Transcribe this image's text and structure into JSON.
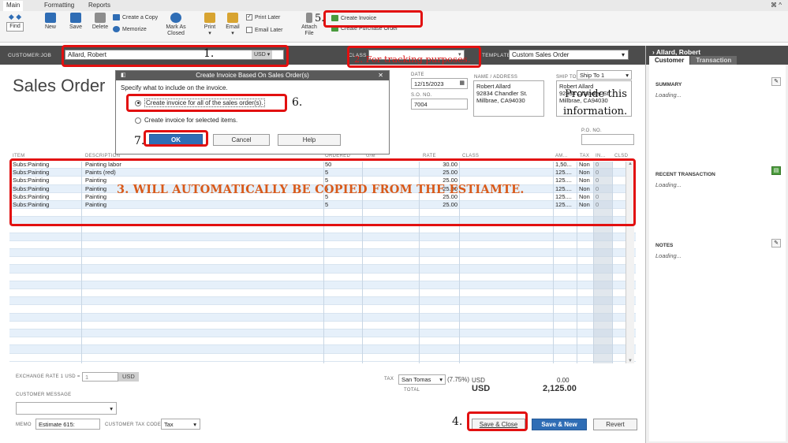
{
  "menu": {
    "tabs": [
      "Main",
      "Formatting",
      "Reports"
    ],
    "window_controls": "⌘ ^"
  },
  "toolbar": {
    "find": "Find",
    "new": "New",
    "save": "Save",
    "delete": "Delete",
    "create_copy": "Create a Copy",
    "memorize": "Memorize",
    "mark_as_closed": [
      "Mark As",
      "Closed"
    ],
    "print": "Print",
    "email": "Email",
    "print_later": "Print Later",
    "email_later": "Email Later",
    "attach_file": [
      "Attach",
      "File"
    ],
    "create_invoice": "Create Invoice",
    "create_purchase_order": "Create Purchase Order"
  },
  "customer_bar": {
    "customer_job_label": "CUSTOMER:JOB",
    "customer_job_value": "Allard, Robert",
    "currency": "USD",
    "class_label": "CLASS",
    "template_label": "TEMPLATE",
    "template_value": "Custom Sales Order"
  },
  "side_panel": {
    "customer_name": "Allard, Robert",
    "tabs": [
      "Customer",
      "Transaction"
    ],
    "summary_label": "SUMMARY",
    "recent_label": "RECENT TRANSACTION",
    "notes_label": "NOTES",
    "loading": "Loading..."
  },
  "form": {
    "title": "Sales Order",
    "date_label": "DATE",
    "date_value": "12/15/2023",
    "so_label": "S.O. NO.",
    "so_value": "7004",
    "name_address_label": "NAME / ADDRESS",
    "name_address": [
      "Robert Allard",
      "92834 Chandler St.",
      "Millbrae, CA94030"
    ],
    "ship_to_label": "SHIP TO",
    "ship_to_value": "Ship To 1",
    "ship_address": [
      "Robert Allard",
      "92834 Chandler St.",
      "Millbrae, CA94030"
    ],
    "po_label": "P.O. NO."
  },
  "table": {
    "headers": [
      "ITEM",
      "DESCRIPTION",
      "ORDERED",
      "U/M",
      "RATE",
      "CLASS",
      "AM...",
      "TAX",
      "IN...",
      "CLSD"
    ],
    "rows": [
      {
        "item": "Subs:Painting",
        "desc": "Painting labor",
        "ordered": "50",
        "rate": "30.00",
        "amount": "1,50...",
        "tax": "Non",
        "inv": "0"
      },
      {
        "item": "Subs:Painting",
        "desc": "Paints (red)",
        "ordered": "5",
        "rate": "25.00",
        "amount": "125....",
        "tax": "Non",
        "inv": "0"
      },
      {
        "item": "Subs:Painting",
        "desc": "Painting",
        "ordered": "5",
        "rate": "25.00",
        "amount": "125....",
        "tax": "Non",
        "inv": "0"
      },
      {
        "item": "Subs:Painting",
        "desc": "Painting",
        "ordered": "5",
        "rate": "25.00",
        "amount": "125....",
        "tax": "Non",
        "inv": "0"
      },
      {
        "item": "Subs:Painting",
        "desc": "Painting",
        "ordered": "5",
        "rate": "25.00",
        "amount": "125....",
        "tax": "Non",
        "inv": "0"
      },
      {
        "item": "Subs:Painting",
        "desc": "Painting",
        "ordered": "5",
        "rate": "25.00",
        "amount": "125....",
        "tax": "Non",
        "inv": "0"
      }
    ]
  },
  "footer": {
    "exchange_label": "EXCHANGE RATE 1 USD =",
    "exchange_value": "1",
    "exchange_currency": "USD",
    "customer_message_label": "CUSTOMER MESSAGE",
    "memo_label": "MEMO",
    "memo_value": "Estimate 615:",
    "tax_code_label": "CUSTOMER TAX CODE",
    "tax_code_value": "Tax",
    "tax_label": "TAX",
    "tax_item": "San Tomas",
    "tax_rate": "(7.75%)",
    "tax_currency": "USD",
    "tax_amount": "0.00",
    "total_label": "TOTAL",
    "total_currency": "USD",
    "total_amount": "2,125.00",
    "save_close": "Save & Close",
    "save_new": "Save & New",
    "revert": "Revert"
  },
  "dialog": {
    "title": "Create Invoice Based On Sales Order(s)",
    "prompt": "Specify what to include on the invoice.",
    "option_all": "Create invoice for all of the sales order(s).",
    "option_selected": "Create invoice for selected items.",
    "ok": "OK",
    "cancel": "Cancel",
    "help": "Help"
  },
  "annotations": {
    "n1": "1.",
    "n2": "2. For tracking purposes.",
    "n3": "3. WILL AUTOMATICALLY BE COPIED FROM THE ESTIAMTE.",
    "n4": "4.",
    "n5": "5.",
    "n6": "6.",
    "n7": "7.",
    "provide": [
      "Provide this",
      "information."
    ]
  },
  "colors": {
    "annotation_red": "#e21010",
    "primary_blue": "#2f6db5",
    "header_dark": "#4c4c4c",
    "row_alt": "#e6f0fa"
  }
}
